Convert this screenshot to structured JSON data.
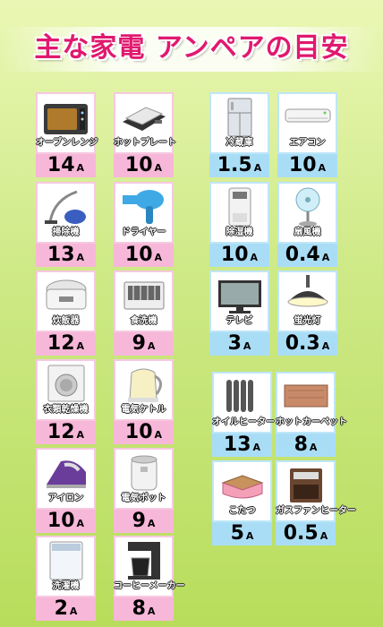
{
  "title": "主な家電 アンペアの目安",
  "unit": "A",
  "appliances": [
    {
      "name": "オーブンレンジ",
      "amp": "14",
      "icon": "microwave-oven-icon"
    },
    {
      "name": "ホットプレート",
      "amp": "10",
      "icon": "hot-plate-icon"
    },
    {
      "name": "冷蔵庫",
      "amp": "1.5",
      "icon": "refrigerator-icon"
    },
    {
      "name": "エアコン",
      "amp": "10",
      "icon": "air-conditioner-icon"
    },
    {
      "name": "掃除機",
      "amp": "13",
      "icon": "vacuum-cleaner-icon"
    },
    {
      "name": "ドライヤー",
      "amp": "10",
      "icon": "hair-dryer-icon"
    },
    {
      "name": "除湿機",
      "amp": "10",
      "icon": "dehumidifier-icon"
    },
    {
      "name": "扇風機",
      "amp": "0.4",
      "icon": "electric-fan-icon"
    },
    {
      "name": "炊飯器",
      "amp": "12",
      "icon": "rice-cooker-icon"
    },
    {
      "name": "食洗機",
      "amp": "9",
      "icon": "dishwasher-icon"
    },
    {
      "name": "テレビ",
      "amp": "3",
      "icon": "television-icon"
    },
    {
      "name": "蛍光灯",
      "amp": "0.3",
      "icon": "fluorescent-lamp-icon"
    },
    {
      "name": "衣類乾燥機",
      "amp": "12",
      "icon": "clothes-dryer-icon"
    },
    {
      "name": "電気ケトル",
      "amp": "10",
      "icon": "electric-kettle-icon"
    },
    {
      "name": "オイルヒーター",
      "amp": "13",
      "icon": "oil-heater-icon"
    },
    {
      "name": "ホットカーペット",
      "amp": "8",
      "icon": "hot-carpet-icon"
    },
    {
      "name": "アイロン",
      "amp": "10",
      "icon": "iron-icon"
    },
    {
      "name": "電気ポット",
      "amp": "9",
      "icon": "electric-pot-icon"
    },
    {
      "name": "こたつ",
      "amp": "5",
      "icon": "kotatsu-icon"
    },
    {
      "name": "ガスファンヒーター",
      "amp": "0.5",
      "icon": "gas-fan-heater-icon"
    },
    {
      "name": "洗濯機",
      "amp": "2",
      "icon": "washing-machine-icon"
    },
    {
      "name": "コーヒーメーカー",
      "amp": "8",
      "icon": "coffee-maker-icon"
    }
  ]
}
